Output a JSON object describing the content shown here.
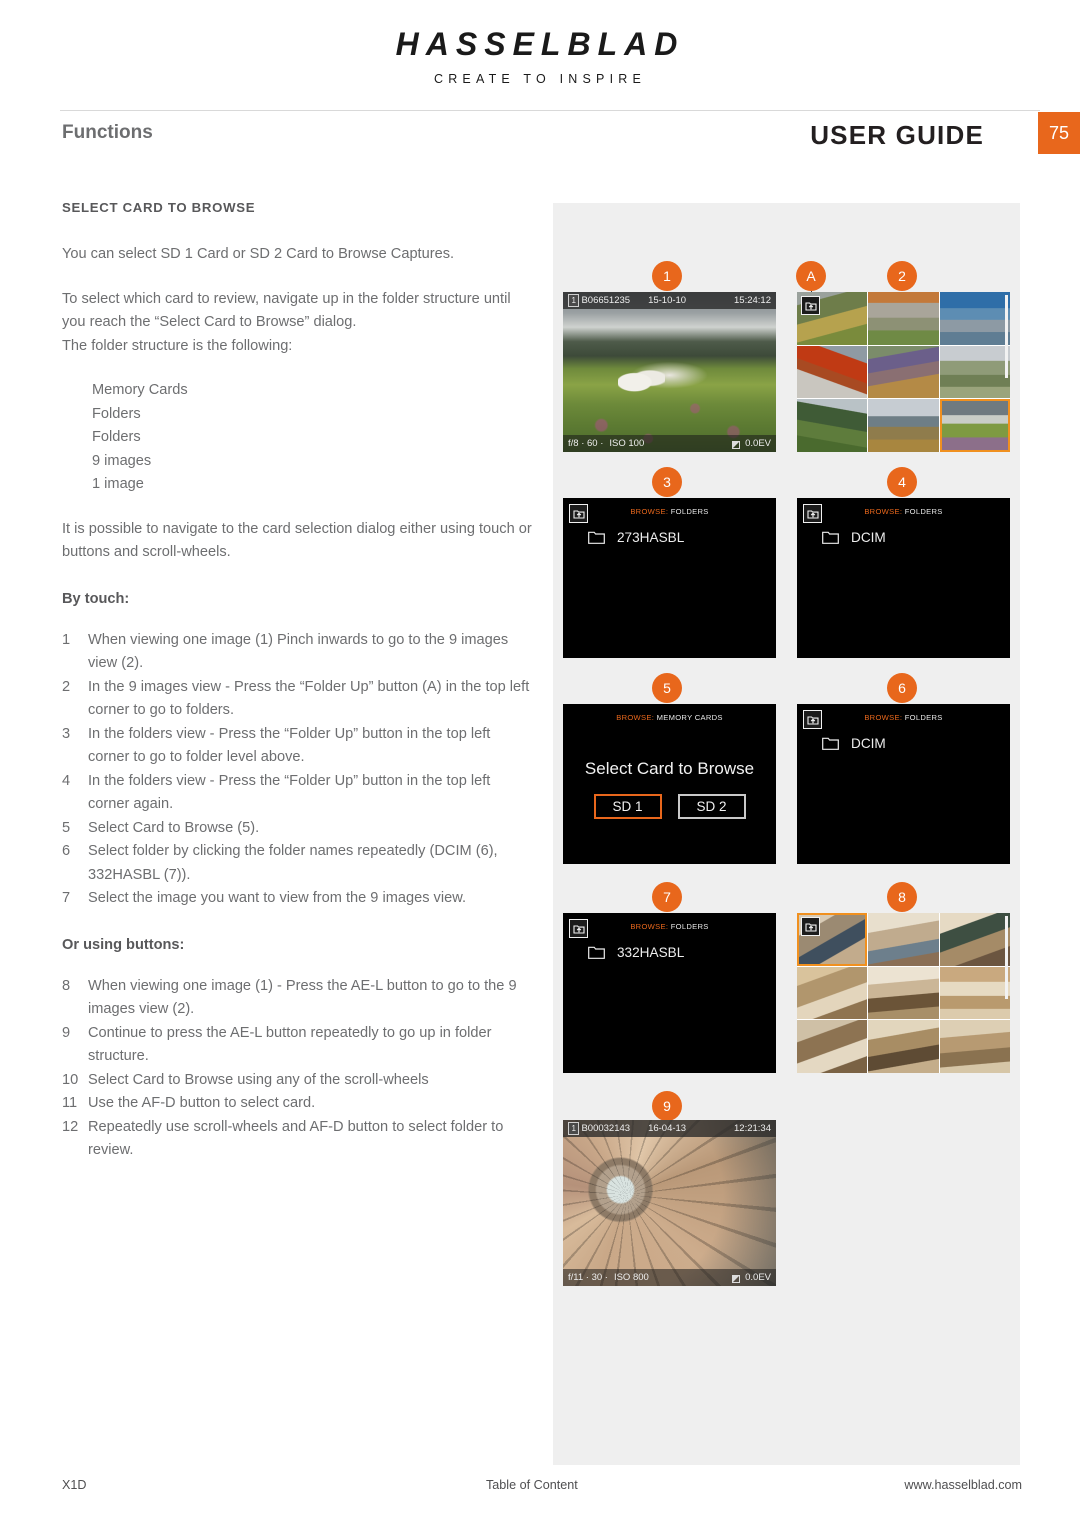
{
  "brand": {
    "name": "HASSELBLAD",
    "tagline": "CREATE TO INSPIRE"
  },
  "header": {
    "section_title": "Functions",
    "doc_title": "USER GUIDE",
    "page_number": "75",
    "accent_color": "#e8671c"
  },
  "content": {
    "section_heading": "SELECT CARD TO BROWSE",
    "paragraph_1": "You can select SD 1 Card or SD 2 Card to Browse Captures.",
    "paragraph_2a": "To select which card to review, navigate up in the folder structure until you reach the “Select Card to Browse” dialog.",
    "paragraph_2b": "The folder structure is the following:",
    "folder_structure": [
      "Memory Cards",
      "Folders",
      "Folders",
      "9 images",
      "1 image"
    ],
    "paragraph_3": "It is possible to navigate to the card selection dialog either using touch or buttons and scroll-wheels.",
    "touch_heading": "By touch:",
    "touch_steps": [
      {
        "num": "1",
        "text": "When viewing one image (1)  Pinch inwards to go to the 9 images view (2)."
      },
      {
        "num": "2",
        "text": "In the 9 images view - Press the “Folder Up” button (A) in the top left corner to go to folders."
      },
      {
        "num": "3",
        "text": "In the folders view - Press the “Folder Up” button in the top left corner to go to folder level above."
      },
      {
        "num": "4",
        "text": "In the folders view - Press the “Folder Up” button in the top left corner again."
      },
      {
        "num": "5",
        "text": "Select Card to Browse (5)."
      },
      {
        "num": "6",
        "text": "Select folder by clicking the folder names repeatedly (DCIM (6), 332HASBL (7))."
      },
      {
        "num": "7",
        "text": "Select the image you want to view from the 9 images view."
      }
    ],
    "buttons_heading": "Or using buttons:",
    "button_steps": [
      {
        "num": "8",
        "text": "When viewing one image (1) - Press the AE-L button to go to the 9 images view (2)."
      },
      {
        "num": "9",
        "text": "Continue to press the AE-L button repeatedly to go up in folder structure."
      },
      {
        "num": "10",
        "text": "Select Card to Browse using any of the scroll-wheels"
      },
      {
        "num": "11",
        "text": "Use the AF-D button to select card."
      },
      {
        "num": "12",
        "text": "Repeatedly use scroll-wheels and AF-D button to select folder to review."
      }
    ]
  },
  "figure": {
    "callouts": {
      "c1": "1",
      "cA": "A",
      "c2": "2",
      "c3": "3",
      "c4": "4",
      "c5": "5",
      "c6": "6",
      "c7": "7",
      "c8": "8",
      "c9": "9"
    },
    "screen1": {
      "card": "1",
      "filename": "B06651235",
      "date": "15-10-10",
      "time": "15:24:12",
      "aperture": "f/8 · 60 ·",
      "iso": "ISO 100",
      "ev": "0.0EV",
      "folder_up_icon": "folder-up-icon"
    },
    "screen9": {
      "card": "1",
      "filename": "B00032143",
      "date": "16-04-13",
      "time": "12:21:34",
      "aperture": "f/11 · 30 ·",
      "iso": "ISO 800",
      "ev": "0.0EV"
    },
    "screen3": {
      "browse_prefix": "BROWSE:",
      "browse_value": "FOLDERS",
      "folder_name": "273HASBL"
    },
    "screen4": {
      "browse_prefix": "BROWSE:",
      "browse_value": "FOLDERS",
      "folder_name": "DCIM"
    },
    "screen5": {
      "browse_prefix": "BROWSE:",
      "browse_value": "MEMORY CARDS",
      "dialog_title": "Select Card to Browse",
      "btn_sd1": "SD 1",
      "btn_sd2": "SD 2",
      "selected": "SD 1"
    },
    "screen6": {
      "browse_prefix": "BROWSE:",
      "browse_value": "FOLDERS",
      "folder_name": "DCIM"
    },
    "screen7": {
      "browse_prefix": "BROWSE:",
      "browse_value": "FOLDERS",
      "folder_name": "332HASBL"
    }
  },
  "footer": {
    "model": "X1D",
    "toc_link": "Table of Content",
    "website": "www.hasselblad.com"
  }
}
